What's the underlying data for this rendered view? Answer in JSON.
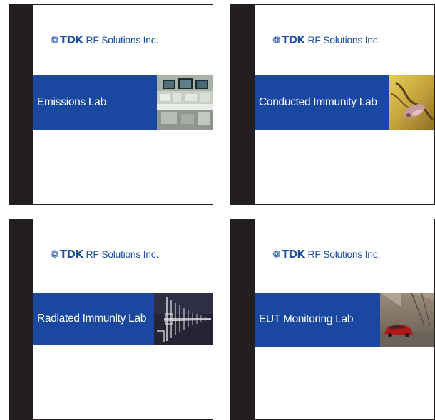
{
  "brand": {
    "mark": "❁",
    "name": "TDK",
    "company": "RF Solutions Inc."
  },
  "cards": [
    {
      "title": "Emissions Lab",
      "photo": "control-room-monitors-photo"
    },
    {
      "title": "Conducted Immunity Lab",
      "photo": "cable-coupling-clamp-photo"
    },
    {
      "title": "Radiated Immunity Lab",
      "photo": "log-periodic-antenna-photo"
    },
    {
      "title": "EUT Monitoring Lab",
      "photo": "vehicle-chamber-photo"
    }
  ],
  "colors": {
    "brand_blue": "#1a47a0",
    "spine": "#231f20",
    "logo_blue": "#1e4fa1"
  }
}
